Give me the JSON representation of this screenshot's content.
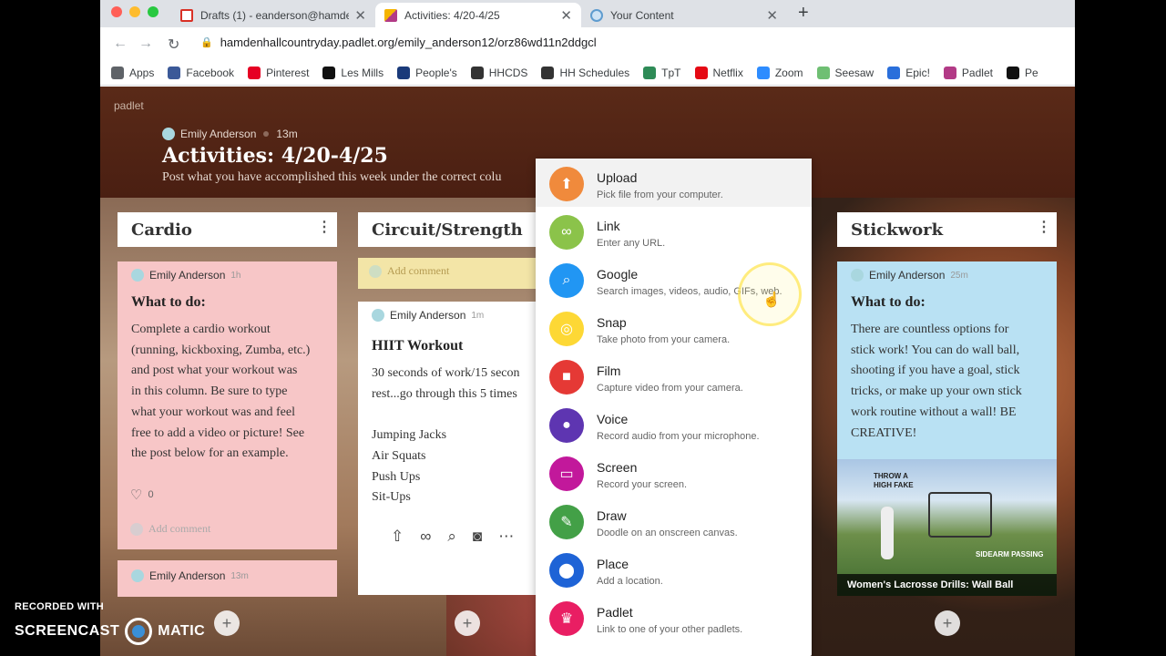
{
  "browser": {
    "tabs": [
      {
        "title": "Drafts (1) - eanderson@hamde",
        "favicon": "gmail-icon",
        "color": "#d93025"
      },
      {
        "title": "Activities: 4/20-4/25",
        "favicon": "padlet-icon",
        "color": "#b23a86"
      },
      {
        "title": "Your Content",
        "favicon": "globe-icon",
        "color": "#5f9ccf"
      }
    ],
    "url": "hamdenhallcountryday.padlet.org/emily_anderson12/orz86wd11n2ddgcl",
    "bookmarks": [
      {
        "label": "Apps",
        "icon": "apps-grid-icon",
        "color": "#5f6368"
      },
      {
        "label": "Facebook",
        "icon": "facebook-icon",
        "color": "#3b5998"
      },
      {
        "label": "Pinterest",
        "icon": "pinterest-icon",
        "color": "#e60023"
      },
      {
        "label": "Les Mills",
        "icon": "lesmills-icon",
        "color": "#111111"
      },
      {
        "label": "People's",
        "icon": "peoples-icon",
        "color": "#1a3a7a"
      },
      {
        "label": "HHCDS",
        "icon": "hhcds-icon",
        "color": "#333333"
      },
      {
        "label": "HH Schedules",
        "icon": "hh-schedules-icon",
        "color": "#333333"
      },
      {
        "label": "TpT",
        "icon": "tpt-icon",
        "color": "#2e8b57"
      },
      {
        "label": "Netflix",
        "icon": "netflix-icon",
        "color": "#e50914"
      },
      {
        "label": "Zoom",
        "icon": "zoom-icon",
        "color": "#2d8cff"
      },
      {
        "label": "Seesaw",
        "icon": "seesaw-icon",
        "color": "#6fbf73"
      },
      {
        "label": "Epic!",
        "icon": "epic-icon",
        "color": "#2a6fdb"
      },
      {
        "label": "Padlet",
        "icon": "padlet-icon",
        "color": "#b23a86"
      },
      {
        "label": "Pe",
        "icon": "pe-icon",
        "color": "#111111"
      }
    ]
  },
  "board": {
    "logo": "padlet",
    "author": "Emily Anderson",
    "time": "13m",
    "title": "Activities: 4/20-4/25",
    "description": "Post what you have accomplished this week under the correct colu"
  },
  "columns": [
    {
      "title": "Cardio"
    },
    {
      "title": "Circuit/Strength"
    },
    {
      "title": "Stickwork"
    }
  ],
  "cards": {
    "cardio_main": {
      "author": "Emily Anderson",
      "time": "1h",
      "title": "What to do:",
      "body": "Complete a cardio workout\n(running, kickboxing, Zumba, etc.)\nand post what your workout was\nin this column. Be sure to type\nwhat your workout was and feel\nfree to add a video or picture! See\nthe post below for an example.",
      "likes": "0",
      "add_comment": "Add comment"
    },
    "cardio_second": {
      "author": "Emily Anderson",
      "time": "13m"
    },
    "circuit_comment": {
      "add_comment": "Add comment"
    },
    "circuit_hiit": {
      "author": "Emily Anderson",
      "time": "1m",
      "title": "HIIT Workout",
      "body": "30 seconds of work/15 secon\nrest...go through this 5 times\n\nJumping Jacks\nAir Squats\nPush Ups\nSit-Ups"
    },
    "stickwork_main": {
      "author": "Emily Anderson",
      "time": "25m",
      "title": "What to do:",
      "body": "There are countless options for\nstick work! You can do wall ball,\nshooting if you have a goal, stick\ntricks, or make up your own stick\nwork routine without a wall! BE\nCREATIVE!",
      "video_caption": "Women's Lacrosse Drills: Wall Ball",
      "video_overlay_1": "THROW A\nHIGH FAKE",
      "video_overlay_2": "SIDEARM PASSING"
    }
  },
  "attach_menu": [
    {
      "label": "Upload",
      "sub": "Pick file from your computer.",
      "icon": "upload-icon",
      "color": "#f08a3c",
      "glyph": "⬆"
    },
    {
      "label": "Link",
      "sub": "Enter any URL.",
      "icon": "link-icon",
      "color": "#8bc34a",
      "glyph": "∞"
    },
    {
      "label": "Google",
      "sub": "Search images, videos, audio, GIFs, web.",
      "icon": "magnifier-icon",
      "color": "#2196f3",
      "glyph": "⌕"
    },
    {
      "label": "Snap",
      "sub": "Take photo from your camera.",
      "icon": "camera-icon",
      "color": "#fdd835",
      "glyph": "◎"
    },
    {
      "label": "Film",
      "sub": "Capture video from your camera.",
      "icon": "video-camera-icon",
      "color": "#e53935",
      "glyph": "■"
    },
    {
      "label": "Voice",
      "sub": "Record audio from your microphone.",
      "icon": "microphone-icon",
      "color": "#5e35b1",
      "glyph": "●"
    },
    {
      "label": "Screen",
      "sub": "Record your screen.",
      "icon": "screen-record-icon",
      "color": "#c2189b",
      "glyph": "▭"
    },
    {
      "label": "Draw",
      "sub": "Doodle on an onscreen canvas.",
      "icon": "pencil-icon",
      "color": "#43a047",
      "glyph": "✎"
    },
    {
      "label": "Place",
      "sub": "Add a location.",
      "icon": "map-pin-icon",
      "color": "#1e63d6",
      "glyph": "⬤"
    },
    {
      "label": "Padlet",
      "sub": "Link to one of your other padlets.",
      "icon": "padlet-crown-icon",
      "color": "#e91e63",
      "glyph": "♛"
    }
  ],
  "watermark": {
    "line1": "RECORDED WITH",
    "left": "SCREENCAST",
    "right": "MATIC"
  }
}
